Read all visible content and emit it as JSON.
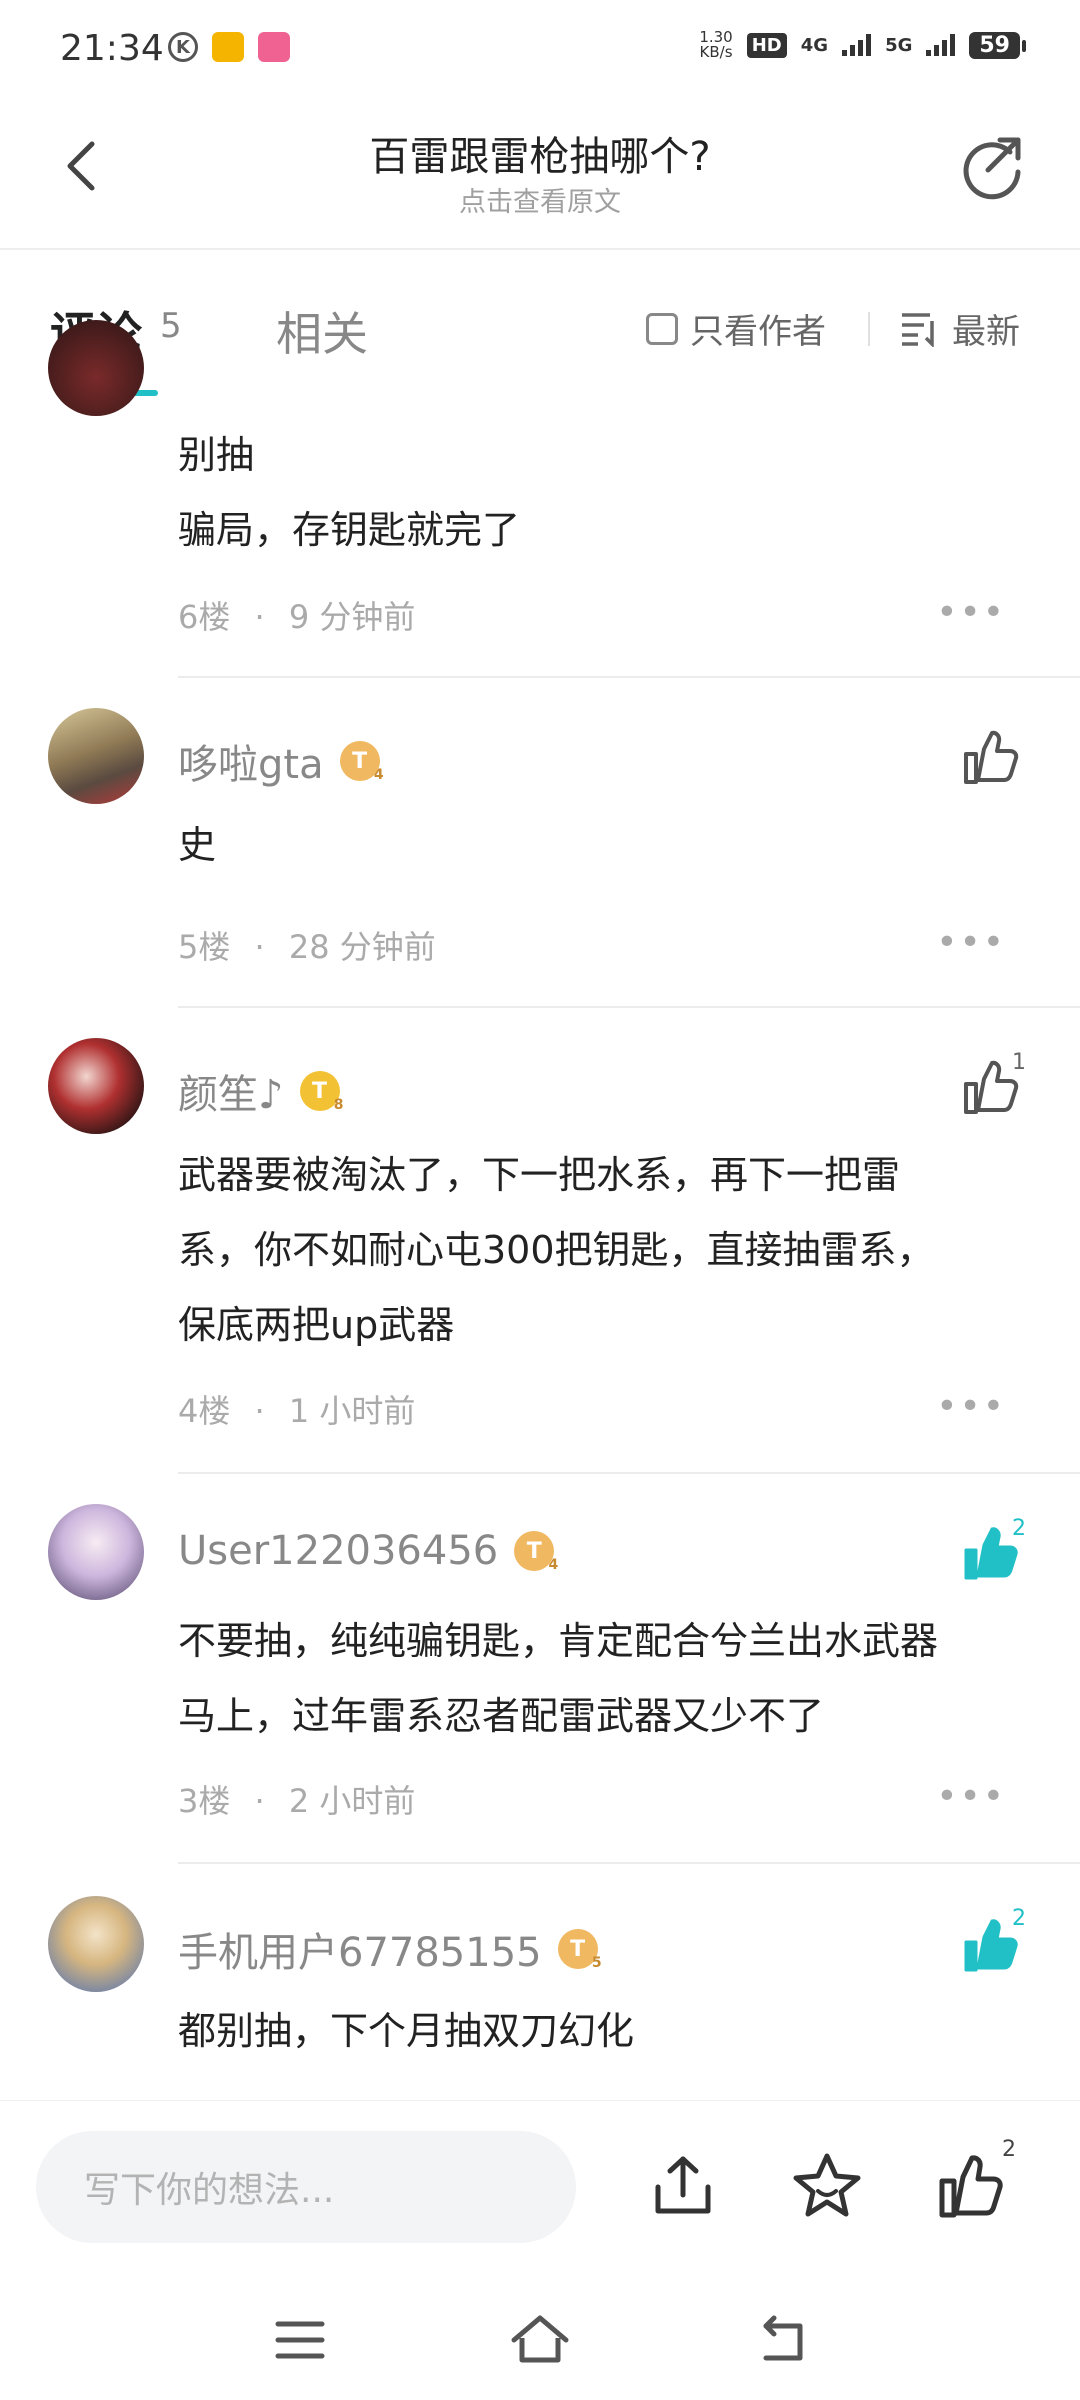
{
  "status_bar": {
    "time": "21:34",
    "speed_top": "1.30",
    "speed_bottom": "KB/s",
    "hd": "HD",
    "net1": "4G",
    "net2": "5G",
    "battery": "59"
  },
  "header": {
    "title": "百雷跟雷枪抽哪个?",
    "subtitle": "点击查看原文"
  },
  "tabs": {
    "comments_label": "评论",
    "comments_count": "5",
    "related_label": "相关",
    "only_author_label": "只看作者",
    "sort_label": "最新"
  },
  "comments": [
    {
      "lines": [
        "别抽",
        "骗局，存钥匙就完了"
      ],
      "floor": "6楼",
      "time": "9 分钟前"
    },
    {
      "username": "哆啦gta",
      "level": "T",
      "level_num": "4",
      "lines": [
        "史"
      ],
      "floor": "5楼",
      "time": "28 分钟前",
      "likes": ""
    },
    {
      "username": "颜笙♪",
      "level": "T",
      "level_num": "8",
      "lines": [
        "武器要被淘汰了，下一把水系，再下一把雷",
        "系，你不如耐心屯300把钥匙，直接抽雷系，",
        "保底两把up武器"
      ],
      "floor": "4楼",
      "time": "1 小时前",
      "likes": "1"
    },
    {
      "username": "User122036456",
      "level": "T",
      "level_num": "4",
      "lines": [
        "不要抽，纯纯骗钥匙，肯定配合兮兰出水武器",
        "马上，过年雷系忍者配雷武器又少不了"
      ],
      "floor": "3楼",
      "time": "2 小时前",
      "likes": "2"
    },
    {
      "username": "手机用户67785155",
      "level": "T",
      "level_num": "5",
      "lines": [
        "都别抽，下个月抽双刀幻化"
      ],
      "likes": "2"
    }
  ],
  "meta_dot": "·",
  "more_glyph": "•••",
  "bottom_bar": {
    "input_placeholder": "写下你的想法...",
    "like_count": "2"
  },
  "colors": {
    "accent": "#21c0c6",
    "text_primary": "#222222",
    "text_secondary": "#888888",
    "level_badge": "#f0b860"
  }
}
